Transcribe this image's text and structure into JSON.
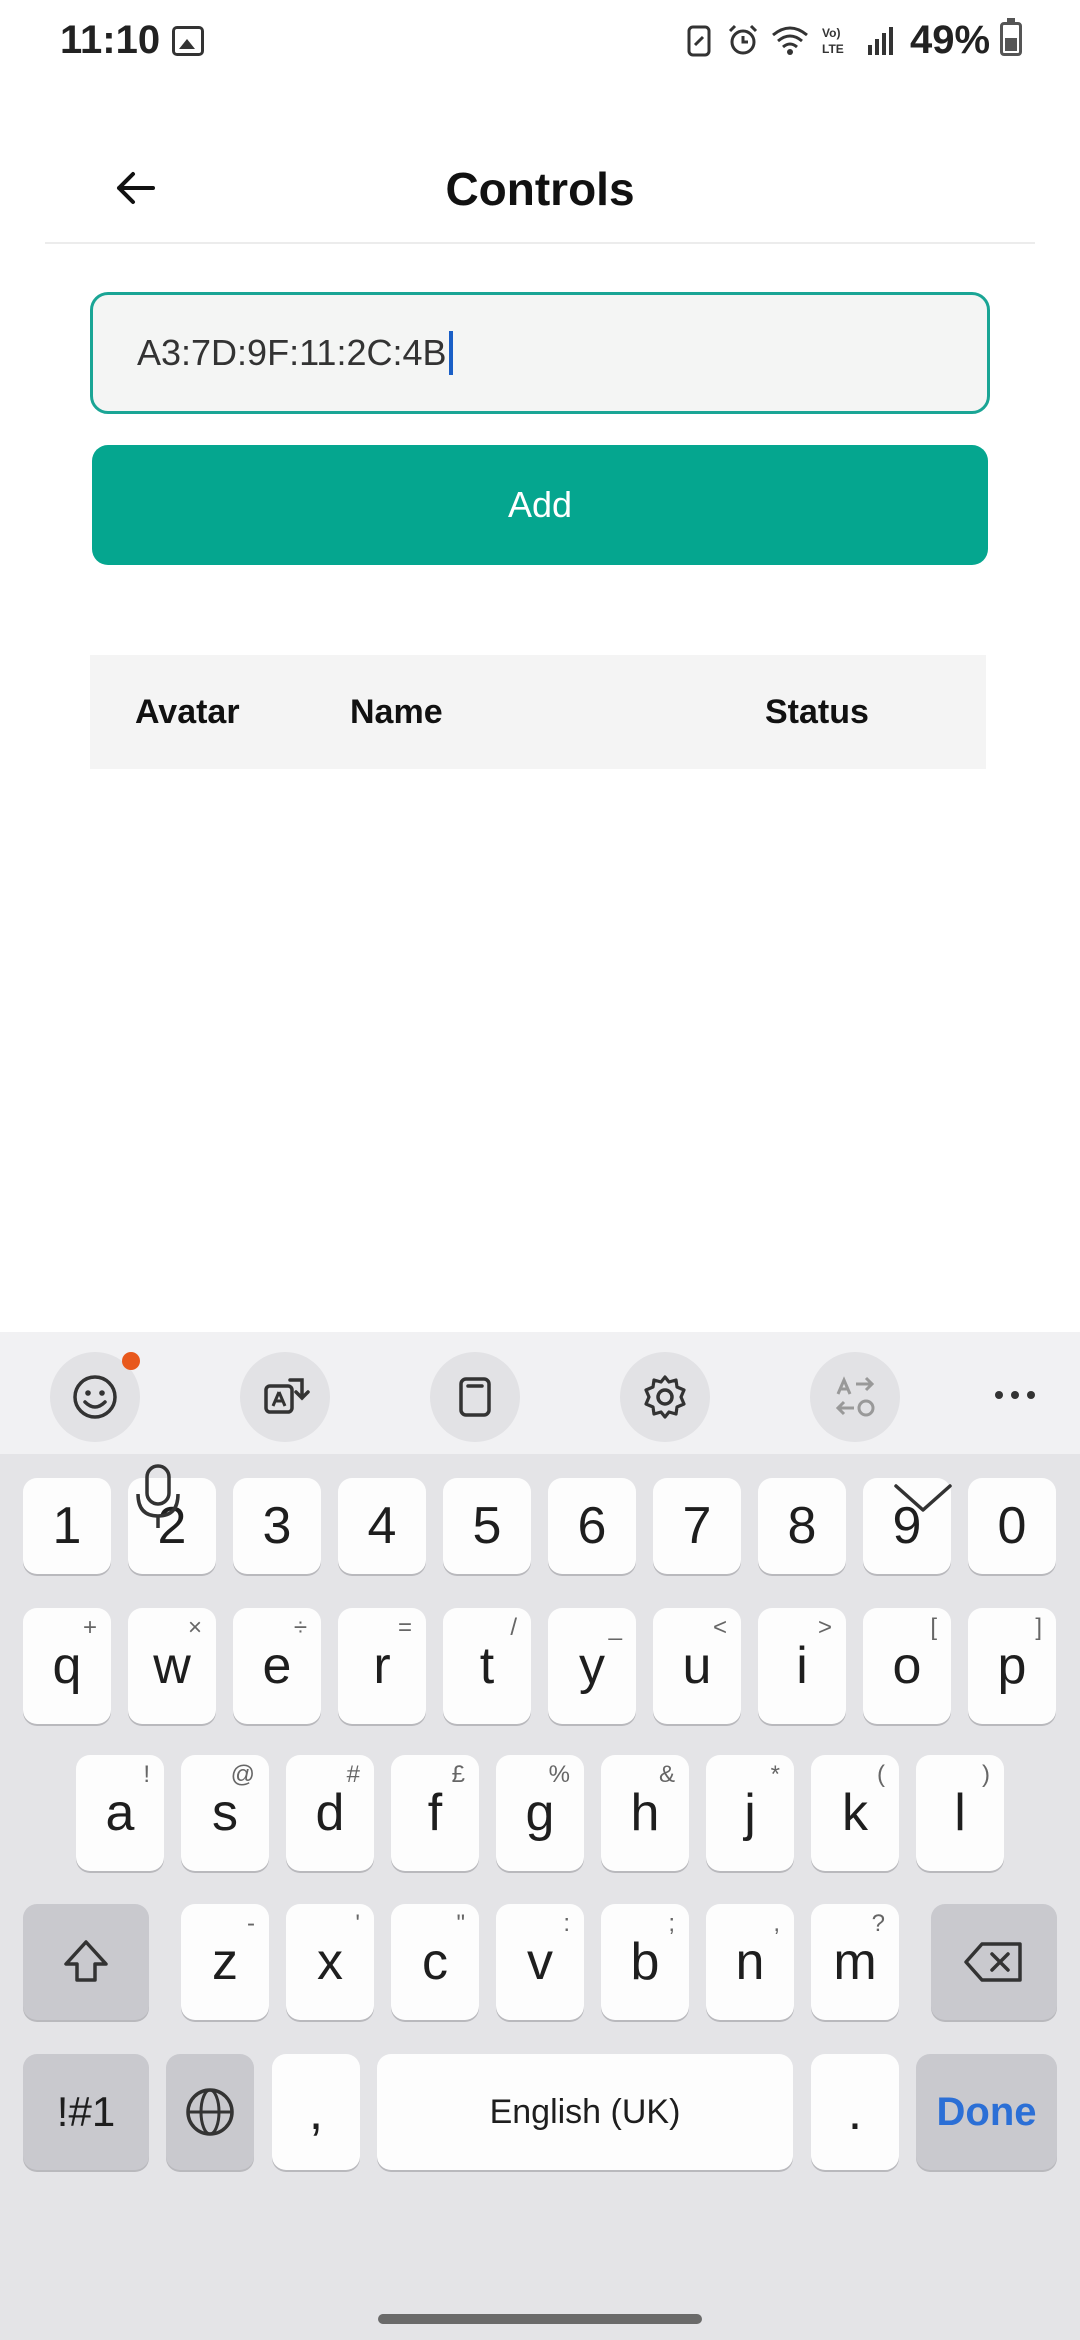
{
  "status_bar": {
    "time": "11:10",
    "battery_percent": "49%",
    "icons": [
      "gallery-icon",
      "battery-saver-icon",
      "alarm-icon",
      "wifi-icon",
      "volte-icon",
      "signal-icon",
      "battery-icon"
    ]
  },
  "header": {
    "title": "Controls",
    "back_icon": "arrow-left-icon"
  },
  "mac_input": {
    "value": "A3:7D:9F:11:2C:4B"
  },
  "add_button": {
    "label": "Add",
    "color": "#05a68f"
  },
  "table": {
    "columns": [
      "Avatar",
      "Name",
      "Status"
    ],
    "rows": []
  },
  "keyboard": {
    "toolbar": [
      "emoji-icon",
      "translate-icon",
      "clipboard-icon",
      "settings-icon",
      "text-convert-icon",
      "more-icon"
    ],
    "number_row": [
      "1",
      "2",
      "3",
      "4",
      "5",
      "6",
      "7",
      "8",
      "9",
      "0"
    ],
    "row1": [
      {
        "key": "q",
        "sub": "+"
      },
      {
        "key": "w",
        "sub": "×"
      },
      {
        "key": "e",
        "sub": "÷"
      },
      {
        "key": "r",
        "sub": "="
      },
      {
        "key": "t",
        "sub": "/"
      },
      {
        "key": "y",
        "sub": "_"
      },
      {
        "key": "u",
        "sub": "<"
      },
      {
        "key": "i",
        "sub": ">"
      },
      {
        "key": "o",
        "sub": "["
      },
      {
        "key": "p",
        "sub": "]"
      }
    ],
    "row2": [
      {
        "key": "a",
        "sub": "!"
      },
      {
        "key": "s",
        "sub": "@"
      },
      {
        "key": "d",
        "sub": "#"
      },
      {
        "key": "f",
        "sub": "£"
      },
      {
        "key": "g",
        "sub": "%"
      },
      {
        "key": "h",
        "sub": "&"
      },
      {
        "key": "j",
        "sub": "*"
      },
      {
        "key": "k",
        "sub": "("
      },
      {
        "key": "l",
        "sub": ")"
      }
    ],
    "row3": [
      {
        "key": "z",
        "sub": "-"
      },
      {
        "key": "x",
        "sub": "'"
      },
      {
        "key": "c",
        "sub": "\""
      },
      {
        "key": "v",
        "sub": ":"
      },
      {
        "key": "b",
        "sub": ";"
      },
      {
        "key": "n",
        "sub": ","
      },
      {
        "key": "m",
        "sub": "?"
      }
    ],
    "symbols_label": "!#1",
    "comma": ",",
    "space_label": "English (UK)",
    "period": ".",
    "done_label": "Done",
    "accent": "#2b6fd6"
  }
}
